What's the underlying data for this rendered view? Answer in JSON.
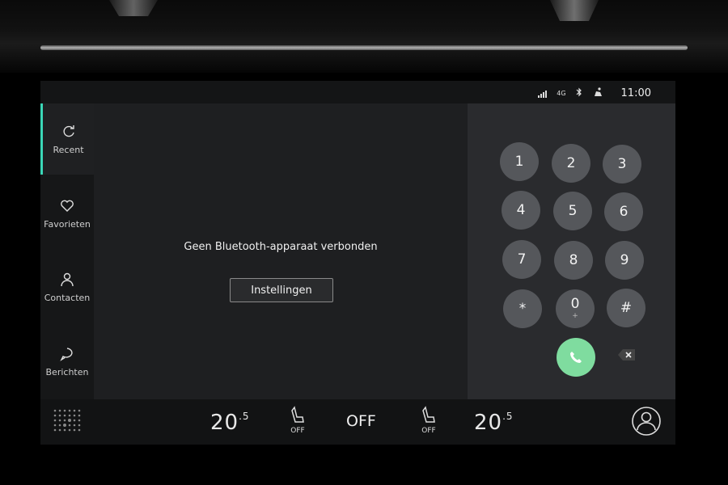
{
  "status": {
    "signal_icon": "signal-bars-icon",
    "network": "4G",
    "bluetooth_icon": "bluetooth-icon",
    "seatbelt_icon": "seat-icon",
    "time": "11:00"
  },
  "sidebar": {
    "items": [
      {
        "label": "Recent",
        "icon": "recent-icon",
        "active": true
      },
      {
        "label": "Favorieten",
        "icon": "heart-icon",
        "active": false
      },
      {
        "label": "Contacten",
        "icon": "person-icon",
        "active": false
      },
      {
        "label": "Berichten",
        "icon": "chat-bubble-icon",
        "active": false
      }
    ]
  },
  "main": {
    "message": "Geen Bluetooth-apparaat verbonden",
    "settings_button": "Instellingen"
  },
  "keypad": {
    "keys": [
      {
        "main": "1",
        "sub": ""
      },
      {
        "main": "2",
        "sub": ""
      },
      {
        "main": "3",
        "sub": ""
      },
      {
        "main": "4",
        "sub": ""
      },
      {
        "main": "5",
        "sub": ""
      },
      {
        "main": "6",
        "sub": ""
      },
      {
        "main": "7",
        "sub": ""
      },
      {
        "main": "8",
        "sub": ""
      },
      {
        "main": "9",
        "sub": ""
      },
      {
        "main": "*",
        "sub": ""
      },
      {
        "main": "0",
        "sub": "+"
      },
      {
        "main": "#",
        "sub": ""
      }
    ],
    "call_color": "#7fdc9f"
  },
  "climate": {
    "left_temp": "20",
    "left_temp_decimal": ".5",
    "left_seat_label": "OFF",
    "fan": "OFF",
    "right_seat_label": "OFF",
    "right_temp": "20",
    "right_temp_decimal": ".5"
  },
  "colors": {
    "accent": "#3ad6b7",
    "call": "#7fdc9f",
    "key": "#55575b"
  }
}
